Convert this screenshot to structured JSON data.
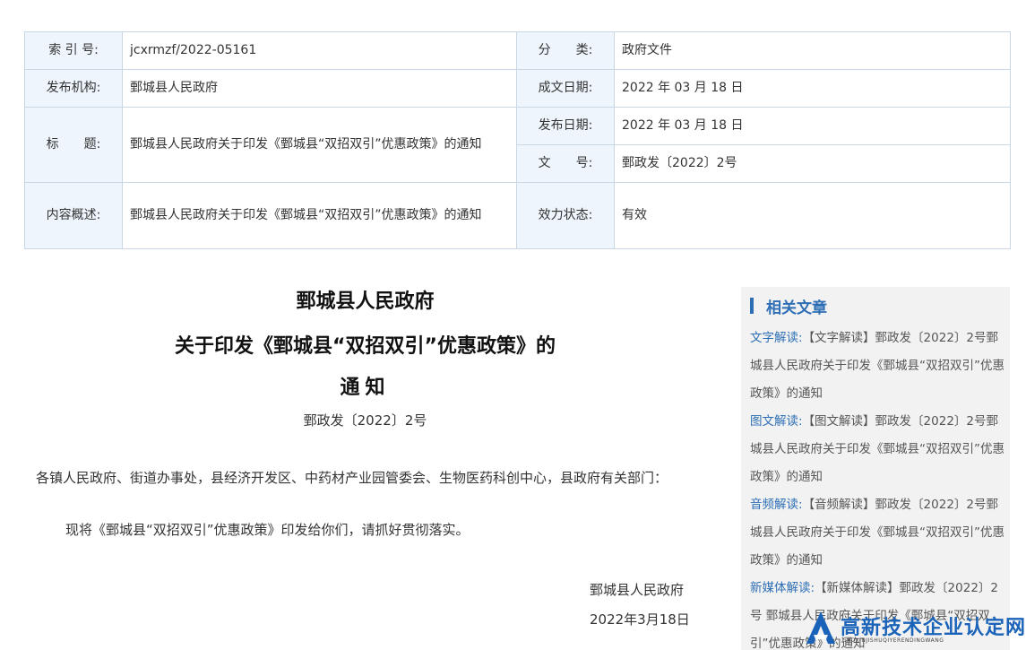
{
  "meta": {
    "index_label": "索 引 号:",
    "index_value": "jcxrmzf/2022-05161",
    "category_label": "分　　类:",
    "category_value": "政府文件",
    "publisher_label": "发布机构:",
    "publisher_value": "鄄城县人民政府",
    "created_label": "成文日期:",
    "created_value": "2022 年 03 月 18 日",
    "title_label": "标　　题:",
    "title_value": "鄄城县人民政府关于印发《鄄城县“双招双引”优惠政策》的通知",
    "published_label": "发布日期:",
    "published_value": "2022 年 03 月 18 日",
    "docno_label": "文　　号:",
    "docno_value": "鄄政发〔2022〕2号",
    "summary_label": "内容概述:",
    "summary_value": "鄄城县人民政府关于印发《鄄城县“双招双引”优惠政策》的通知",
    "status_label": "效力状态:",
    "status_value": "有效"
  },
  "article": {
    "title_line1": "鄄城县人民政府",
    "title_line2": "关于印发《鄄城县“双招双引”优惠政策》的",
    "title_line3": "通知",
    "doc_number": "鄄政发〔2022〕2号",
    "addressee": "各镇人民政府、街道办事处，县经济开发区、中药材产业园管委会、生物医药科创中心，县政府有关部门：",
    "body": "现将《鄄城县“双招双引”优惠政策》印发给你们，请抓好贯彻落实。",
    "signature_org": "鄄城县人民政府",
    "signature_date": "2022年3月18日"
  },
  "sidebar": {
    "title": "相关文章",
    "items": [
      {
        "category": "文字解读:",
        "text": "【文字解读】鄄政发〔2022〕2号鄄城县人民政府关于印发《鄄城县“双招双引”优惠政策》的通知"
      },
      {
        "category": "图文解读:",
        "text": "【图文解读】鄄政发〔2022〕2号鄄城县人民政府关于印发《鄄城县“双招双引”优惠政策》的通知"
      },
      {
        "category": "音频解读:",
        "text": "【音频解读】鄄政发〔2022〕2号鄄城县人民政府关于印发《鄄城县“双招双引”优惠政策》的通知"
      },
      {
        "category": "新媒体解读:",
        "text": "【新媒体解读】鄄政发〔2022〕2号 鄄城县人民政府关于印发《鄄城县“双招双引”优惠政策》的通知"
      }
    ]
  },
  "watermark": {
    "text": "高新技术企业认定网",
    "subtext": "GAOXINJISHUQIYERENDINGWANG",
    "color": "#1a63b8"
  }
}
